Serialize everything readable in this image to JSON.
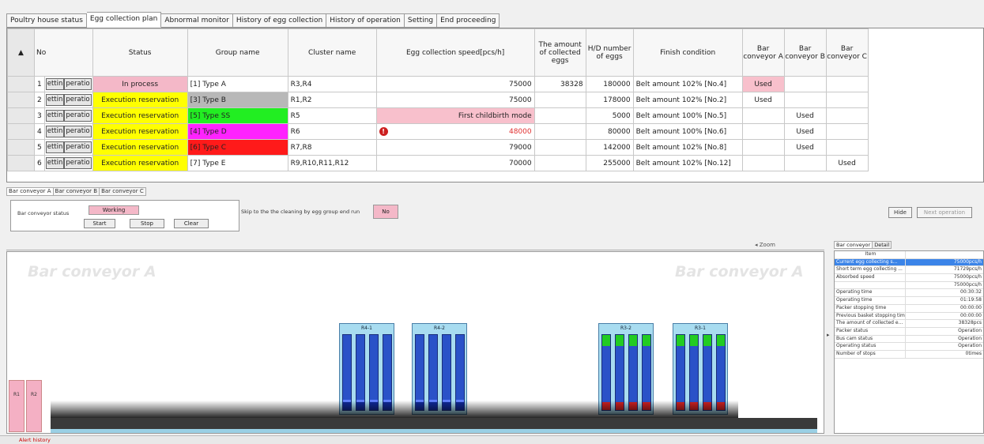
{
  "tabs": [
    "Poultry house status",
    "Egg collection plan",
    "Abnormal monitor",
    "History of egg collection",
    "History of operation",
    "Setting",
    "End proceeding"
  ],
  "active_tab": 1,
  "table": {
    "columns": {
      "no": "No",
      "status": "Status",
      "group": "Group name",
      "cluster": "Cluster name",
      "speed": "Egg collection speed[pcs/h]",
      "amount": "The amount of collected eggs",
      "hd": "H/D number of eggs",
      "finish": "Finish condition",
      "bca": "Bar conveyor A",
      "bcb": "Bar conveyor B",
      "bcc": "Bar conveyor C"
    },
    "btn1": "ettin",
    "btn2": "peratio",
    "rows": [
      {
        "no": "1",
        "status": "In process",
        "group": "[1] Type A",
        "cluster": "R3,R4",
        "speed": "75000",
        "amount": "38328",
        "hd": "180000",
        "finish": "Belt amount 102% [No.4]",
        "bca": "Used",
        "bcb": "",
        "bcc": ""
      },
      {
        "no": "2",
        "status": "Execution reservation",
        "group": "[3] Type B",
        "cluster": "R1,R2",
        "speed": "75000",
        "amount": "",
        "hd": "178000",
        "finish": "Belt amount 102% [No.2]",
        "bca": "Used",
        "bcb": "",
        "bcc": ""
      },
      {
        "no": "3",
        "status": "Execution reservation",
        "group": "[5] Type SS",
        "cluster": "R5",
        "speed": "First childbirth mode",
        "amount": "",
        "hd": "5000",
        "finish": "Belt amount 100% [No.5]",
        "bca": "",
        "bcb": "Used",
        "bcc": ""
      },
      {
        "no": "4",
        "status": "Execution reservation",
        "group": "[4] Type D",
        "cluster": "R6",
        "speed": "48000",
        "amount": "",
        "hd": "80000",
        "finish": "Belt amount 100% [No.6]",
        "bca": "",
        "bcb": "Used",
        "bcc": ""
      },
      {
        "no": "5",
        "status": "Execution reservation",
        "group": "[6] Type C",
        "cluster": "R7,R8",
        "speed": "79000",
        "amount": "",
        "hd": "142000",
        "finish": "Belt amount 102% [No.8]",
        "bca": "",
        "bcb": "Used",
        "bcc": ""
      },
      {
        "no": "6",
        "status": "Execution reservation",
        "group": "[7] Type E",
        "cluster": "R9,R10,R11,R12",
        "speed": "70000",
        "amount": "",
        "hd": "255000",
        "finish": "Belt amount 102% [No.12]",
        "bca": "",
        "bcb": "",
        "bcc": "Used"
      }
    ]
  },
  "subtabs": [
    "Bar conveyor A",
    "Bar conveyor B",
    "Bar conveyor C"
  ],
  "control": {
    "label": "Bar conveyor status",
    "status": "Working",
    "start": "Start",
    "stop": "Stop",
    "clear": "Clear",
    "skip_label": "Skip to the the cleaning by egg group end run",
    "skip_value": "No",
    "right_btn1": "Hide",
    "right_btn2": "Next operation"
  },
  "conveyor": {
    "watermark": "Bar conveyor A",
    "zoom_label": "Zoom",
    "units": [
      {
        "label": "R4-1"
      },
      {
        "label": "R4-2"
      },
      {
        "label": "R3-2"
      },
      {
        "label": "R3-1"
      }
    ],
    "pink_blocks": [
      "R1",
      "R2"
    ]
  },
  "right_panel": {
    "tabs": [
      "Bar conveyor",
      "Detail"
    ],
    "header": "Item",
    "rows": [
      {
        "k": "Current egg collecting s...",
        "v": "75000pcs/h"
      },
      {
        "k": "Short term egg collecting ...",
        "v": "71729pcs/h"
      },
      {
        "k": "Absorbed speed",
        "v": "75000pcs/h"
      },
      {
        "k": "",
        "v": "75000pcs/h"
      },
      {
        "k": "Operating time",
        "v": "00:30:32"
      },
      {
        "k": "Operating time",
        "v": "01:19:58"
      },
      {
        "k": "Packer stopping time",
        "v": "00:00:00"
      },
      {
        "k": "Previous basket stopping time",
        "v": "00:00:00"
      },
      {
        "k": "The amount of collected e...",
        "v": "38328pcs"
      },
      {
        "k": "Packer status",
        "v": "Operation"
      },
      {
        "k": "Bus cam status",
        "v": "Operation"
      },
      {
        "k": "Operating status",
        "v": "Operation"
      },
      {
        "k": "Number of stops",
        "v": "0times"
      }
    ]
  },
  "statusbar": "Alert history"
}
